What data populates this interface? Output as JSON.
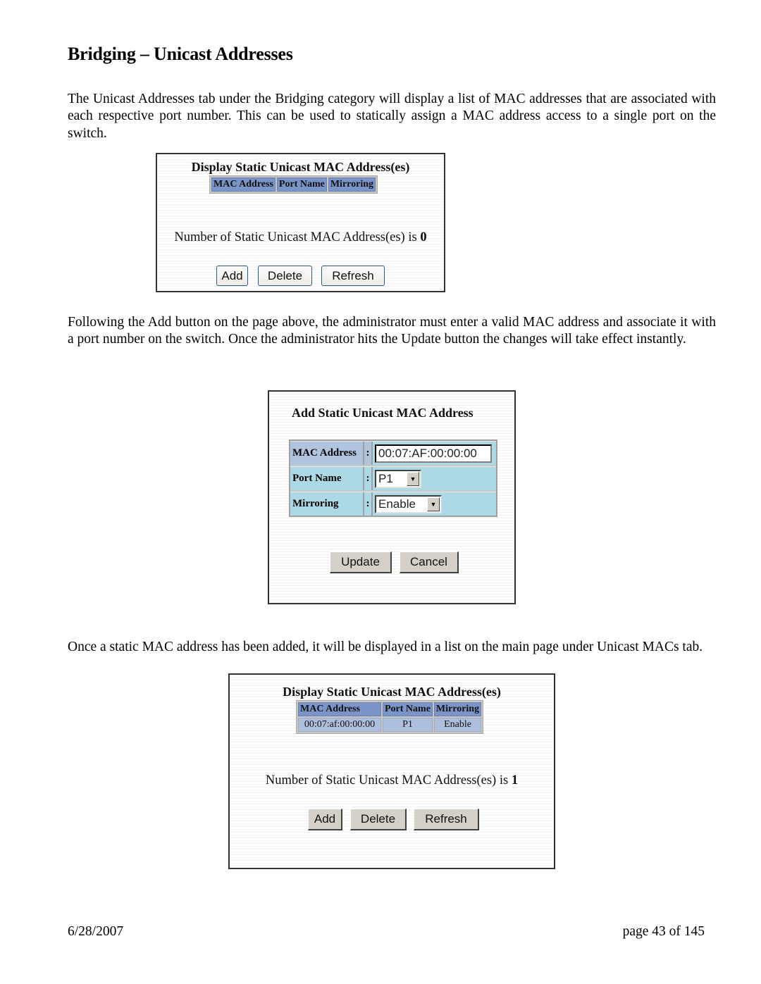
{
  "document": {
    "title": "Bridging – Unicast Addresses",
    "paragraphs": [
      "The Unicast Addresses tab under the Bridging category will display a list of MAC addresses that are associated with each respective port number.  This can be used to statically assign a MAC address access to a single port on the switch.",
      "Following the Add button on the page above, the administrator must enter a valid MAC address and associate it with a port number on the switch.  Once the administrator hits the Update button the changes will take effect instantly.",
      "Once a static MAC address has been added, it will be displayed in a list on the main page under Unicast MACs tab."
    ],
    "footer": {
      "date": "6/28/2007",
      "page": "page 43 of 145"
    }
  },
  "screenshot1": {
    "title": "Display Static Unicast MAC Address(es)",
    "columns": [
      "MAC Address",
      "Port Name",
      "Mirroring"
    ],
    "rows": [],
    "count_label": "Number of Static Unicast MAC Address(es) is",
    "count_value": "0",
    "buttons": {
      "add": "Add",
      "delete": "Delete",
      "refresh": "Refresh"
    }
  },
  "screenshot2": {
    "title": "Add Static Unicast MAC Address",
    "fields": {
      "mac_label": "MAC Address",
      "mac_value": "00:07:AF:00:00:00",
      "port_label": "Port Name",
      "port_value": "P1",
      "mirroring_label": "Mirroring",
      "mirroring_value": "Enable",
      "separator": ":"
    },
    "buttons": {
      "update": "Update",
      "cancel": "Cancel"
    }
  },
  "screenshot3": {
    "title": "Display Static Unicast MAC Address(es)",
    "columns": [
      "MAC Address",
      "Port Name",
      "Mirroring"
    ],
    "rows": [
      {
        "mac": "00:07:af:00:00:00",
        "port": "P1",
        "mirroring": "Enable"
      }
    ],
    "count_label": "Number of Static Unicast MAC Address(es) is",
    "count_value": "1",
    "buttons": {
      "add": "Add",
      "delete": "Delete",
      "refresh": "Refresh"
    }
  },
  "colors": {
    "table_header": "#7b95c8",
    "table_cell": "#aebfde",
    "form_row": "#add8e6",
    "form_header_row": "#b0c4de",
    "button_face": "#d4d0c8"
  }
}
